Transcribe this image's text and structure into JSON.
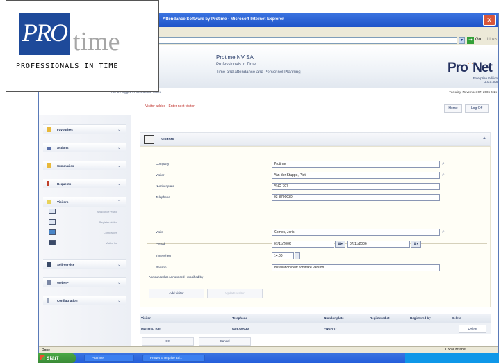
{
  "browser": {
    "title": "Attendance Software by Protime - Microsoft Internet Explorer",
    "go_label": "Go",
    "links_label": "Links",
    "status_left": "Done",
    "status_zone": "Local intranet"
  },
  "header": {
    "company": "Protime NV SA",
    "slogan": "Professionals in Time",
    "subtitle": "Time and attendance and Personnel Planning",
    "product_pro": "Pro",
    "product_net": "Net",
    "edition_line1": "Enterprise Edition",
    "edition_line2": "2.0.0.308",
    "logged_in": "You are logged in as: Dupont Andrée",
    "datetime": "Tuesday, November 07, 2006 4:15"
  },
  "status_message": "Visitor added - Enter next visitor",
  "top_buttons": {
    "home": "Home",
    "logoff": "Log Off"
  },
  "sidebar": {
    "items": [
      {
        "label": "Favourites"
      },
      {
        "label": "Actions"
      },
      {
        "label": "Summaries"
      },
      {
        "label": "Requests"
      },
      {
        "label": "Visitors"
      },
      {
        "label": "Self-service"
      },
      {
        "label": "WebPIP"
      },
      {
        "label": "Configuration"
      }
    ],
    "subitems": [
      {
        "label": "Announce visitor"
      },
      {
        "label": "Register visitor"
      },
      {
        "label": "Companies"
      },
      {
        "label": "Visitor list"
      }
    ]
  },
  "panel": {
    "title": "Visitors",
    "company_label": "Company",
    "company_value": "Protime",
    "visitor_label": "Visitor",
    "visitor_value": "Van der Stappe, Piet",
    "plate_label": "Number plate",
    "plate_value": "VNG-707",
    "phone_label": "Telephone",
    "phone_value": "03-8700030",
    "visits_label": "Visits",
    "visits_value": "Gomes, Joris",
    "period_label": "Period",
    "period_from": "07/11/2006",
    "period_to": "07/11/2006",
    "time_label": "Time when",
    "time_value": "14:00",
    "reason_label": "Reason",
    "reason_value": "Installation new software version",
    "announced_label": "Announced at Announced I modified by",
    "add_visitor": "Add visitor",
    "update_visitor": "Update visitor"
  },
  "grid": {
    "headers": [
      "Visitor",
      "Telephone",
      "Number plate",
      "Registered at",
      "Registered by",
      "Delete"
    ],
    "rows": [
      {
        "visitor": "Martens, Tom",
        "telephone": "03-8700030",
        "plate": "VNG-707",
        "delete": "Delete"
      }
    ]
  },
  "footer_buttons": {
    "ok": "OK",
    "cancel": "Cancel"
  },
  "taskbar": {
    "start": "start",
    "tasks": [
      "ProTime",
      "ProNet Enterprise Ed..."
    ]
  },
  "overlay_logo": {
    "pro": "PRO",
    "time": "time",
    "tagline": "PROFESSIONALS IN TIME"
  },
  "colors": {
    "brand_blue": "#1e4a9a",
    "accent_orange": "#e0771b",
    "error_red": "#c0302a",
    "xp_title_blue": "#245edb"
  }
}
